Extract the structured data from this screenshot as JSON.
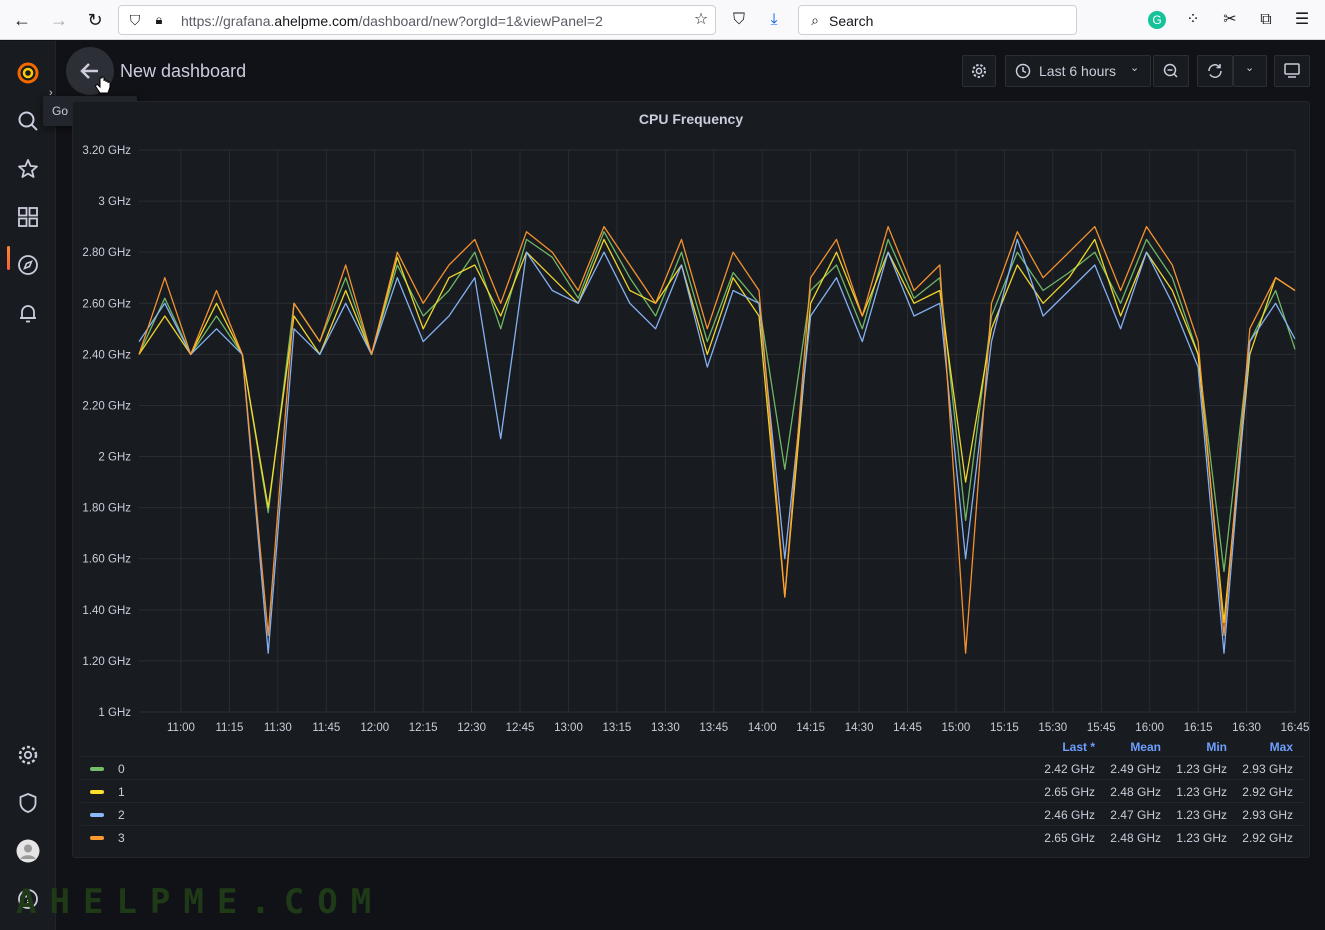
{
  "browser": {
    "url_prefix": "https://grafana.",
    "url_domain": "ahelpme.com",
    "url_suffix": "/dashboard/new?orgId=1&viewPanel=2",
    "search_placeholder": "Search"
  },
  "topnav": {
    "title": "New dashboard",
    "back_tooltip": "Go back (Esc)",
    "time_picker_label": "Last 6 hours"
  },
  "panel": {
    "title": "CPU Frequency"
  },
  "legend": {
    "headers": [
      "Last *",
      "Mean",
      "Min",
      "Max"
    ],
    "rows": [
      {
        "name": "0",
        "color": "#73bf69",
        "last": "2.42 GHz",
        "mean": "2.49 GHz",
        "min": "1.23 GHz",
        "max": "2.93 GHz"
      },
      {
        "name": "1",
        "color": "#fade2a",
        "last": "2.65 GHz",
        "mean": "2.48 GHz",
        "min": "1.23 GHz",
        "max": "2.92 GHz"
      },
      {
        "name": "2",
        "color": "#8ab8ff",
        "last": "2.46 GHz",
        "mean": "2.47 GHz",
        "min": "1.23 GHz",
        "max": "2.93 GHz"
      },
      {
        "name": "3",
        "color": "#ff9830",
        "last": "2.65 GHz",
        "mean": "2.48 GHz",
        "min": "1.23 GHz",
        "max": "2.92 GHz"
      }
    ]
  },
  "watermark": "AHELPME.COM",
  "chart_data": {
    "type": "line",
    "title": "CPU Frequency",
    "ylabel": "",
    "xlabel": "",
    "unit": "GHz",
    "ylim": [
      1.0,
      3.2
    ],
    "y_ticks": [
      "1 GHz",
      "1.20 GHz",
      "1.40 GHz",
      "1.60 GHz",
      "1.80 GHz",
      "2 GHz",
      "2.20 GHz",
      "2.40 GHz",
      "2.60 GHz",
      "2.80 GHz",
      "3 GHz",
      "3.20 GHz"
    ],
    "y_tick_values": [
      1.0,
      1.2,
      1.4,
      1.6,
      1.8,
      2.0,
      2.2,
      2.4,
      2.6,
      2.8,
      3.0,
      3.2
    ],
    "x_ticks": [
      "11:00",
      "11:15",
      "11:30",
      "11:45",
      "12:00",
      "12:15",
      "12:30",
      "12:45",
      "13:00",
      "13:15",
      "13:30",
      "13:45",
      "14:00",
      "14:15",
      "14:30",
      "14:45",
      "15:00",
      "15:15",
      "15:30",
      "15:45",
      "16:00",
      "16:15",
      "16:30",
      "16:45"
    ],
    "xlim": [
      "10:47",
      "16:45"
    ],
    "grid": true,
    "legend_placement": "bottom",
    "x": [
      "10:47",
      "10:55",
      "11:03",
      "11:11",
      "11:19",
      "11:27",
      "11:35",
      "11:43",
      "11:51",
      "11:59",
      "12:07",
      "12:15",
      "12:23",
      "12:31",
      "12:39",
      "12:47",
      "12:55",
      "13:03",
      "13:11",
      "13:19",
      "13:27",
      "13:35",
      "13:43",
      "13:51",
      "13:59",
      "14:07",
      "14:15",
      "14:23",
      "14:31",
      "14:39",
      "14:47",
      "14:55",
      "15:03",
      "15:11",
      "15:19",
      "15:27",
      "15:35",
      "15:43",
      "15:51",
      "15:59",
      "16:07",
      "16:15",
      "16:23",
      "16:31",
      "16:39",
      "16:45"
    ],
    "series": [
      {
        "name": "0",
        "color": "#73bf69",
        "values": [
          2.4,
          2.62,
          2.4,
          2.55,
          2.4,
          1.78,
          2.6,
          2.45,
          2.7,
          2.4,
          2.75,
          2.55,
          2.65,
          2.8,
          2.5,
          2.85,
          2.78,
          2.62,
          2.88,
          2.7,
          2.55,
          2.8,
          2.45,
          2.72,
          2.6,
          1.95,
          2.65,
          2.75,
          2.5,
          2.85,
          2.62,
          2.7,
          1.75,
          2.55,
          2.8,
          2.65,
          2.72,
          2.8,
          2.6,
          2.85,
          2.7,
          2.4,
          1.55,
          2.45,
          2.65,
          2.42
        ]
      },
      {
        "name": "1",
        "color": "#fade2a",
        "values": [
          2.4,
          2.55,
          2.4,
          2.6,
          2.4,
          1.8,
          2.55,
          2.4,
          2.65,
          2.4,
          2.78,
          2.5,
          2.7,
          2.75,
          2.55,
          2.8,
          2.7,
          2.6,
          2.85,
          2.65,
          2.6,
          2.75,
          2.4,
          2.7,
          2.55,
          1.45,
          2.6,
          2.8,
          2.55,
          2.8,
          2.6,
          2.65,
          1.9,
          2.5,
          2.75,
          2.6,
          2.7,
          2.85,
          2.55,
          2.8,
          2.65,
          2.4,
          1.35,
          2.4,
          2.7,
          2.65
        ]
      },
      {
        "name": "2",
        "color": "#8ab8ff",
        "values": [
          2.45,
          2.6,
          2.4,
          2.5,
          2.4,
          1.23,
          2.5,
          2.4,
          2.6,
          2.4,
          2.7,
          2.45,
          2.55,
          2.7,
          2.07,
          2.8,
          2.65,
          2.6,
          2.8,
          2.6,
          2.5,
          2.75,
          2.35,
          2.65,
          2.6,
          1.6,
          2.55,
          2.7,
          2.45,
          2.8,
          2.55,
          2.6,
          1.6,
          2.45,
          2.85,
          2.55,
          2.65,
          2.75,
          2.5,
          2.8,
          2.6,
          2.35,
          1.23,
          2.45,
          2.6,
          2.46
        ]
      },
      {
        "name": "3",
        "color": "#ff9830",
        "values": [
          2.4,
          2.7,
          2.4,
          2.65,
          2.4,
          1.3,
          2.6,
          2.45,
          2.75,
          2.4,
          2.8,
          2.6,
          2.75,
          2.85,
          2.6,
          2.88,
          2.8,
          2.65,
          2.9,
          2.75,
          2.6,
          2.85,
          2.5,
          2.8,
          2.65,
          1.45,
          2.7,
          2.85,
          2.55,
          2.9,
          2.65,
          2.75,
          1.23,
          2.6,
          2.88,
          2.7,
          2.8,
          2.9,
          2.65,
          2.9,
          2.75,
          2.45,
          1.3,
          2.5,
          2.7,
          2.65
        ]
      }
    ]
  }
}
